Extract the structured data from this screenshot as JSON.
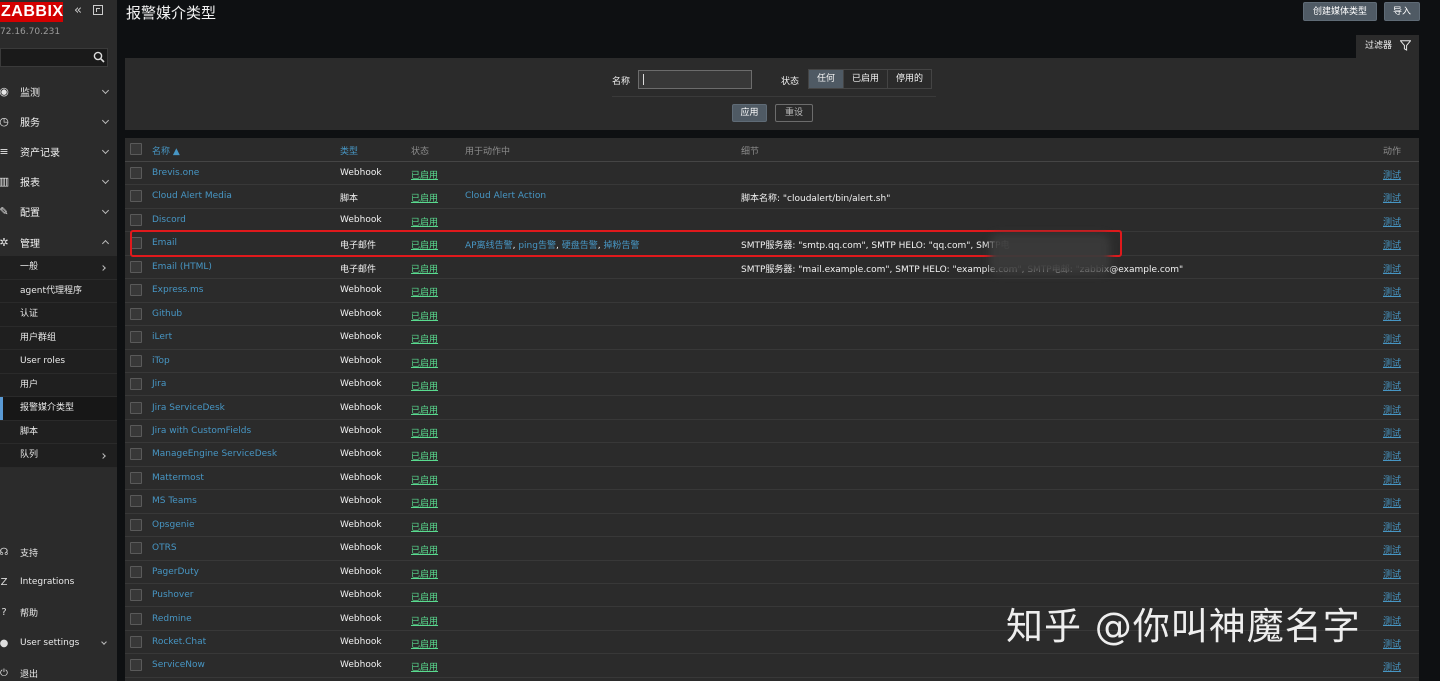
{
  "app": {
    "logo_text": "ZABBIX",
    "server_ip": "72.16.70.231",
    "page_title": "报警媒介类型",
    "create_button": "创建媒体类型",
    "import_button": "导入"
  },
  "sidebar": {
    "nav": [
      {
        "label": "监测",
        "icon": "eye-icon"
      },
      {
        "label": "服务",
        "icon": "clock-icon"
      },
      {
        "label": "资产记录",
        "icon": "list-icon"
      },
      {
        "label": "报表",
        "icon": "bar-chart-icon"
      },
      {
        "label": "配置",
        "icon": "wrench-icon"
      },
      {
        "label": "管理",
        "icon": "gear-icon"
      }
    ],
    "admin_submenu": [
      {
        "label": "一般",
        "has_children": true
      },
      {
        "label": "agent代理程序"
      },
      {
        "label": "认证"
      },
      {
        "label": "用户群组"
      },
      {
        "label": "User roles"
      },
      {
        "label": "用户"
      },
      {
        "label": "报警媒介类型",
        "selected": true
      },
      {
        "label": "脚本"
      },
      {
        "label": "队列",
        "has_children": true
      }
    ],
    "bottom": [
      {
        "label": "支持",
        "icon": "headset-icon"
      },
      {
        "label": "Integrations",
        "icon": "z-icon"
      },
      {
        "label": "帮助",
        "icon": "question-icon"
      },
      {
        "label": "User settings",
        "icon": "user-icon"
      },
      {
        "label": "退出",
        "icon": "power-icon"
      }
    ]
  },
  "filter": {
    "tab_label": "过滤器",
    "name_label": "名称",
    "name_value": "",
    "status_label": "状态",
    "status_options": [
      "任何",
      "已启用",
      "停用的"
    ],
    "status_selected": "任何",
    "apply_label": "应用",
    "reset_label": "重设"
  },
  "table": {
    "headers": {
      "name": "名称 ▲",
      "type": "类型",
      "status": "状态",
      "used_in": "用于动作中",
      "details": "细节",
      "actions": "动作"
    },
    "rows": [
      {
        "name": "Brevis.one",
        "type": "Webhook",
        "status": "已启用",
        "used_in": [],
        "details": "",
        "action": "测试"
      },
      {
        "name": "Cloud Alert Media",
        "type": "脚本",
        "status": "已启用",
        "used_in": [
          "Cloud Alert Action"
        ],
        "details": "脚本名称: \"cloudalert/bin/alert.sh\"",
        "action": "测试"
      },
      {
        "name": "Discord",
        "type": "Webhook",
        "status": "已启用",
        "used_in": [],
        "details": "",
        "action": "测试"
      },
      {
        "name": "Email",
        "type": "电子邮件",
        "status": "已启用",
        "used_in": [
          "AP离线告警",
          "ping告警",
          "硬盘告警",
          "掉粉告警"
        ],
        "details": "SMTP服务器: \"smtp.qq.com\", SMTP HELO: \"qq.com\", SMTP电",
        "action": "测试"
      },
      {
        "name": "Email (HTML)",
        "type": "电子邮件",
        "status": "已启用",
        "used_in": [],
        "details": "SMTP服务器: \"mail.example.com\", SMTP HELO: \"example.com\", SMTP电邮: \"zabbix@example.com\"",
        "action": "测试"
      },
      {
        "name": "Express.ms",
        "type": "Webhook",
        "status": "已启用",
        "used_in": [],
        "details": "",
        "action": "测试"
      },
      {
        "name": "Github",
        "type": "Webhook",
        "status": "已启用",
        "used_in": [],
        "details": "",
        "action": "测试"
      },
      {
        "name": "iLert",
        "type": "Webhook",
        "status": "已启用",
        "used_in": [],
        "details": "",
        "action": "测试"
      },
      {
        "name": "iTop",
        "type": "Webhook",
        "status": "已启用",
        "used_in": [],
        "details": "",
        "action": "测试"
      },
      {
        "name": "Jira",
        "type": "Webhook",
        "status": "已启用",
        "used_in": [],
        "details": "",
        "action": "测试"
      },
      {
        "name": "Jira ServiceDesk",
        "type": "Webhook",
        "status": "已启用",
        "used_in": [],
        "details": "",
        "action": "测试"
      },
      {
        "name": "Jira with CustomFields",
        "type": "Webhook",
        "status": "已启用",
        "used_in": [],
        "details": "",
        "action": "测试"
      },
      {
        "name": "ManageEngine ServiceDesk",
        "type": "Webhook",
        "status": "已启用",
        "used_in": [],
        "details": "",
        "action": "测试"
      },
      {
        "name": "Mattermost",
        "type": "Webhook",
        "status": "已启用",
        "used_in": [],
        "details": "",
        "action": "测试"
      },
      {
        "name": "MS Teams",
        "type": "Webhook",
        "status": "已启用",
        "used_in": [],
        "details": "",
        "action": "测试"
      },
      {
        "name": "Opsgenie",
        "type": "Webhook",
        "status": "已启用",
        "used_in": [],
        "details": "",
        "action": "测试"
      },
      {
        "name": "OTRS",
        "type": "Webhook",
        "status": "已启用",
        "used_in": [],
        "details": "",
        "action": "测试"
      },
      {
        "name": "PagerDuty",
        "type": "Webhook",
        "status": "已启用",
        "used_in": [],
        "details": "",
        "action": "测试"
      },
      {
        "name": "Pushover",
        "type": "Webhook",
        "status": "已启用",
        "used_in": [],
        "details": "",
        "action": "测试"
      },
      {
        "name": "Redmine",
        "type": "Webhook",
        "status": "已启用",
        "used_in": [],
        "details": "",
        "action": "测试"
      },
      {
        "name": "Rocket.Chat",
        "type": "Webhook",
        "status": "已启用",
        "used_in": [],
        "details": "",
        "action": "测试"
      },
      {
        "name": "ServiceNow",
        "type": "Webhook",
        "status": "已启用",
        "used_in": [],
        "details": "",
        "action": "测试"
      }
    ]
  },
  "watermark": "知乎 @你叫神魔名字",
  "colors": {
    "logo_bg": "#d40000",
    "link": "#4796c4",
    "enabled": "#59db8f",
    "highlight": "#e0191c"
  }
}
